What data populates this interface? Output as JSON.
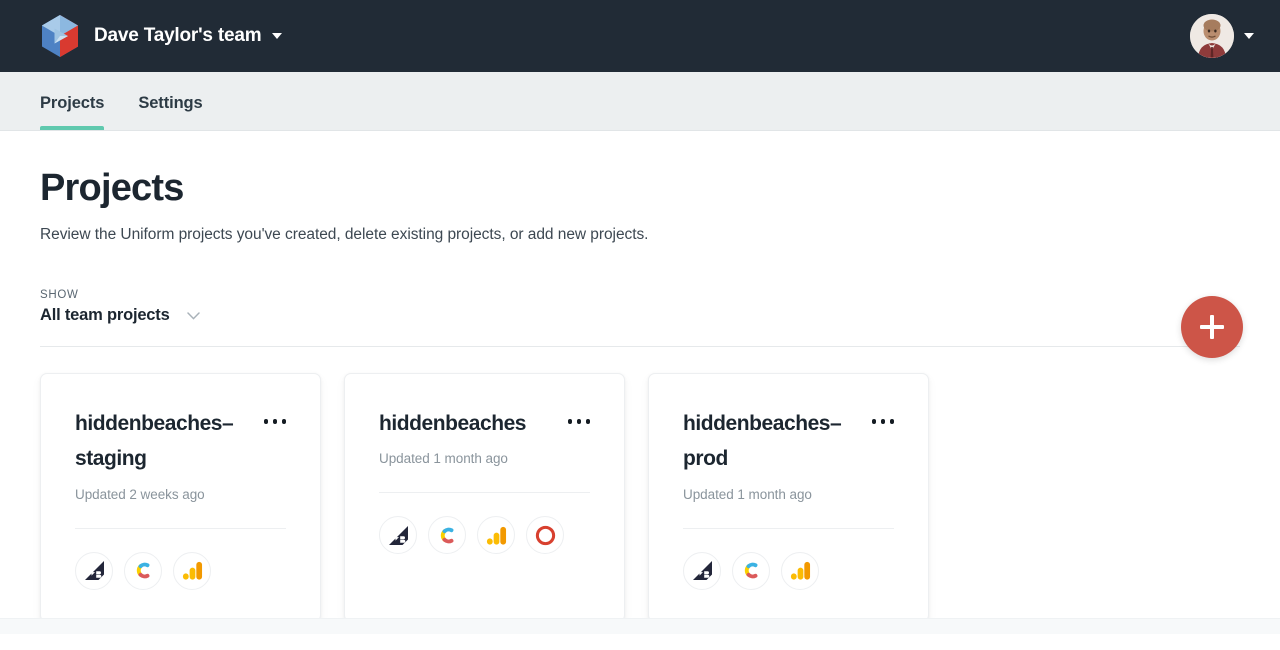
{
  "header": {
    "logo_icon": "uniform-hex-logo",
    "team_name": "Dave Taylor's team",
    "team_caret_icon": "chevron-down-icon",
    "avatar_icon": "user-avatar",
    "avatar_caret_icon": "chevron-down-icon",
    "background_pattern": "isometric-wireframe",
    "background_color": "#212B36"
  },
  "tabs": [
    {
      "label": "Projects",
      "active": true
    },
    {
      "label": "Settings",
      "active": false
    }
  ],
  "tab_accent_color": "#5FC9AE",
  "page": {
    "title": "Projects",
    "subtitle": "Review the Uniform projects you've created, delete existing projects, or add new projects."
  },
  "add_button": {
    "icon": "plus-icon",
    "color": "#CD5548",
    "label": "Add project"
  },
  "filter": {
    "label": "SHOW",
    "value": "All team projects",
    "chevron_icon": "chevron-down-icon"
  },
  "cards": [
    {
      "title": "hiddenbeaches–staging",
      "updated": "Updated 2 weeks ago",
      "menu_icon": "ellipsis-icon",
      "integrations": [
        {
          "name": "bigcommerce-icon",
          "label": "BigCommerce"
        },
        {
          "name": "contentful-icon",
          "label": "Contentful"
        },
        {
          "name": "google-analytics-icon",
          "label": "Google Analytics"
        }
      ]
    },
    {
      "title": "hiddenbeaches",
      "updated": "Updated 1 month ago",
      "menu_icon": "ellipsis-icon",
      "integrations": [
        {
          "name": "bigcommerce-icon",
          "label": "BigCommerce"
        },
        {
          "name": "contentful-icon",
          "label": "Contentful"
        },
        {
          "name": "google-analytics-icon",
          "label": "Google Analytics"
        },
        {
          "name": "optimizely-icon",
          "label": "Optimizely"
        }
      ]
    },
    {
      "title": "hiddenbeaches–prod",
      "updated": "Updated 1 month ago",
      "menu_icon": "ellipsis-icon",
      "integrations": [
        {
          "name": "bigcommerce-icon",
          "label": "BigCommerce"
        },
        {
          "name": "contentful-icon",
          "label": "Contentful"
        },
        {
          "name": "google-analytics-icon",
          "label": "Google Analytics"
        }
      ]
    }
  ]
}
